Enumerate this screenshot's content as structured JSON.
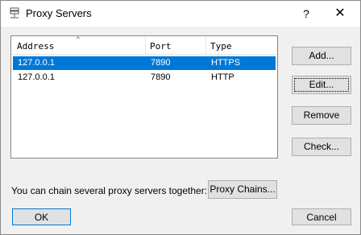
{
  "window": {
    "title": "Proxy Servers",
    "help_label": "?",
    "close_label": "✕"
  },
  "list": {
    "columns": [
      "Address",
      "Port",
      "Type"
    ],
    "sort_indicator": "^",
    "rows": [
      {
        "address": "127.0.0.1",
        "port": "7890",
        "type": "HTTPS",
        "selected": true
      },
      {
        "address": "127.0.0.1",
        "port": "7890",
        "type": "HTTP",
        "selected": false
      }
    ]
  },
  "buttons": {
    "add": "Add...",
    "edit": "Edit...",
    "remove": "Remove",
    "check": "Check...",
    "proxy_chains": "Proxy Chains...",
    "ok": "OK",
    "cancel": "Cancel"
  },
  "chain_text": "You can chain several proxy servers together:",
  "colors": {
    "selection": "#0078d7"
  }
}
